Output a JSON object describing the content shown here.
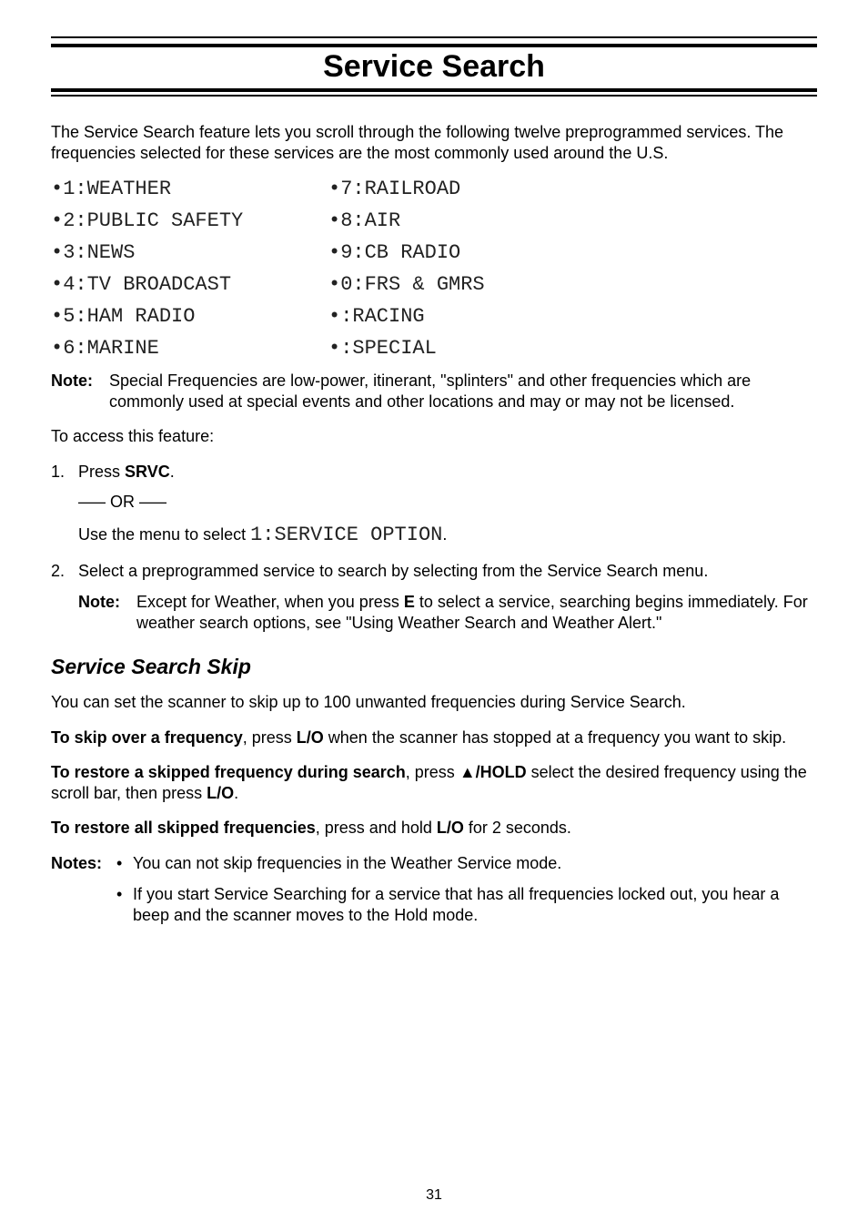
{
  "title": "Service Search",
  "intro": "The Service Search feature lets you scroll through the following twelve preprogrammed services. The frequencies selected for these services are the most commonly used around the U.S.",
  "services_left": [
    "•1:WEATHER",
    "•2:PUBLIC SAFETY",
    "•3:NEWS",
    "•4:TV BROADCAST",
    "•5:HAM RADIO",
    "•6:MARINE"
  ],
  "services_right": [
    "•7:RAILROAD",
    "•8:AIR",
    "•9:CB RADIO",
    "•0:FRS & GMRS",
    "•:RACING",
    "•:SPECIAL"
  ],
  "note1_label": "Note:",
  "note1_text": "Special Frequencies are low-power, itinerant, \"splinters\" and other frequencies which are commonly used at special events and other locations and may or may not be licensed.",
  "access_line": "To access this feature:",
  "step1_num": "1.",
  "step1_prefix": "Press ",
  "step1_key": "SRVC",
  "step1_suffix": ".",
  "or_line": "––– OR –––",
  "menu_prefix": "Use the menu to select ",
  "menu_lcd": "1:SERVICE OPTION",
  "menu_suffix": ".",
  "step2_num": "2.",
  "step2_text": "Select a preprogrammed service to search by selecting from the Service Search menu.",
  "step2_note_label": "Note:",
  "step2_note_a": "Except for Weather, when you press ",
  "step2_note_key": "E",
  "step2_note_b": " to select a service, searching begins immediately. For weather search options, see \"Using Weather Search and Weather Alert.\"",
  "h2": "Service Search Skip",
  "skip_intro": "You can set the scanner to skip up to 100 unwanted frequencies during Service Search.",
  "skip1_bold": "To skip over a frequency",
  "skip1_mid": ", press ",
  "skip1_key": "L/O",
  "skip1_tail": " when the scanner has stopped at a frequency you want to skip.",
  "skip2_bold": "To restore a skipped frequency during search",
  "skip2_mid": ", press ",
  "skip2_key": "▲/HOLD",
  "skip2_tail1": " select the desired frequency using the scroll bar, then press ",
  "skip2_key2": "L/O",
  "skip2_tail2": ".",
  "skip3_bold": "To restore all skipped frequencies",
  "skip3_mid": ", press and hold ",
  "skip3_key": "L/O",
  "skip3_tail": " for 2 seconds.",
  "notes_label": "Notes:",
  "notes_bullet": "•",
  "notes_item1": "You can not skip frequencies in the Weather Service mode.",
  "notes_item2": "If you start Service Searching for a service that has all frequencies locked out, you hear a beep and the scanner moves to the Hold mode.",
  "page_number": "31"
}
